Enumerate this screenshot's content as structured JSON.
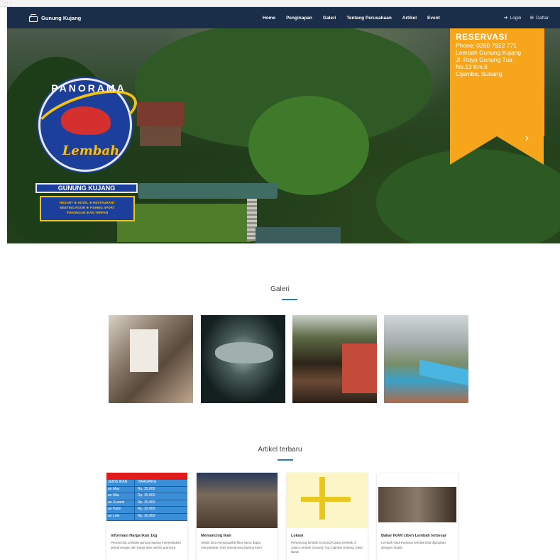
{
  "topbar": {
    "crumbs": "· · ·"
  },
  "navbar": {
    "brand": "Gunung Kujang",
    "items": [
      "Home",
      "Penginapan",
      "Galeri",
      "Tentang Perusahaan",
      "Artikel",
      "Event"
    ],
    "login": "Login",
    "register": "Daftar",
    "colors": {
      "bar": "#1a2e4a",
      "text": "#ffffff"
    }
  },
  "hero": {
    "emblem": {
      "arc_text": "PANORAMA",
      "script_text": "Lembah",
      "banner": "GUNUNG KUJANG",
      "tag_lines": [
        "RESORT ★ HOTEL ★ RESTAURANT",
        "MEETING ROOM ★ FISHING SPORT",
        "POHONGAN IKAN TERPAN"
      ]
    },
    "reservation": {
      "title": "RESERVASI",
      "lines": [
        "Phone: 0260 7922 771",
        "Lembah Gunung Kujang",
        "Jl. Raya Gunung Tua",
        "No.13 Km.8",
        "Cijambe, Subang"
      ],
      "color": "#f7a61c"
    },
    "next_icon": "chevron-right-icon"
  },
  "gallery": {
    "title": "Galeri",
    "items": [
      "gallery-photo-1",
      "gallery-photo-2",
      "gallery-photo-3",
      "gallery-photo-4"
    ]
  },
  "articles": {
    "title": "Artikel terbaru",
    "accent": "#2a7fb8",
    "price_rows": [
      [
        "JENIS IKAN",
        "HARGA/KG"
      ],
      [
        "an Mas",
        "Rp. 35.000"
      ],
      [
        "an Nila",
        "Rp. 35.000"
      ],
      [
        "an Gurami",
        "Rp. 35.000"
      ],
      [
        "an Patin",
        "Rp. 35.000"
      ],
      [
        "an Lele",
        "Rp. 35.000"
      ]
    ],
    "cards": [
      {
        "title": "Informasi Harga Ikan 1kg",
        "body": "Pemancing Lembah gunung kujang menyediakan pemancingan dan harga ikan perkilo gramnya"
      },
      {
        "title": "Memancing Ikan",
        "body": "Selain bisa menginap/berlibur kamu dapat menyalurkan hobi memancing karena kami"
      },
      {
        "title": "Lokasi",
        "body": "Pemancing lembah Gunung Kujang terletak di Jalan Lembah Gunung Tua Cijambe Subang Jawa Barat"
      },
      {
        "title": "Bakar IKAN ciben Lembah terbesar",
        "body": "Lembah Hadi Panama terletak bisa dijangkau dengan mudah"
      }
    ]
  }
}
